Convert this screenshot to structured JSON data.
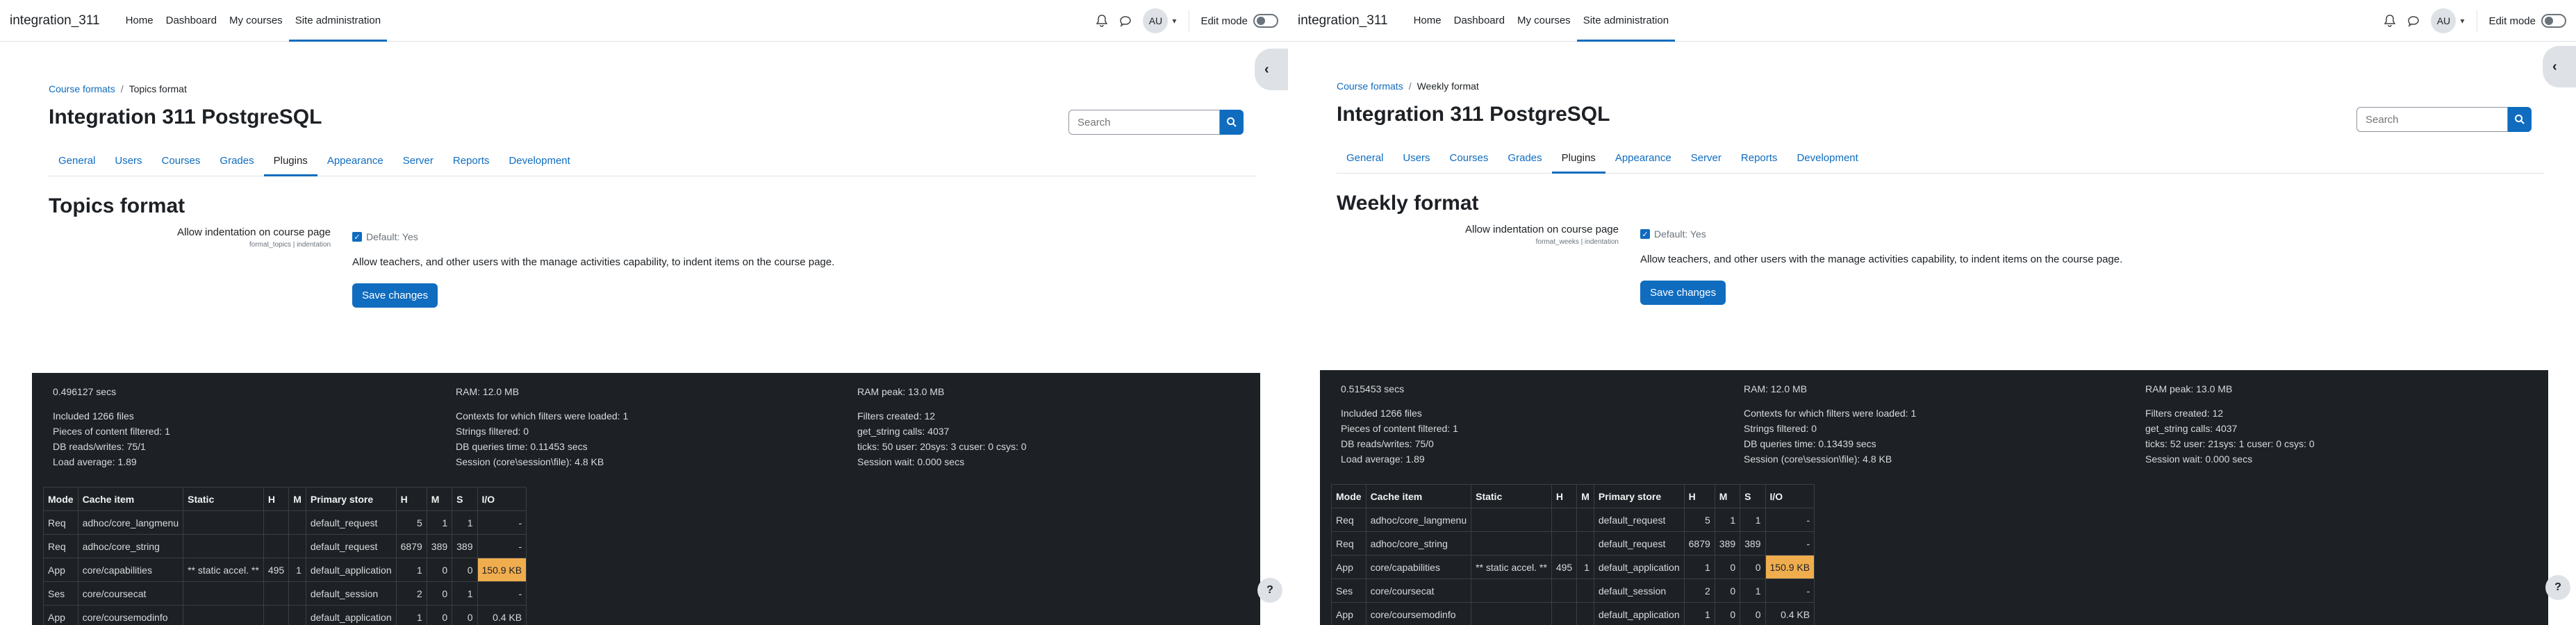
{
  "panels": [
    {
      "site_name": "integration_311",
      "nav": [
        "Home",
        "Dashboard",
        "My courses",
        "Site administration"
      ],
      "nav_active": 3,
      "avatar_initials": "AU",
      "edit_mode_label": "Edit mode",
      "breadcrumb": [
        "Course formats",
        "Topics format"
      ],
      "page_title": "Integration 311 PostgreSQL",
      "search_placeholder": "Search",
      "tabs": [
        "General",
        "Users",
        "Courses",
        "Grades",
        "Plugins",
        "Appearance",
        "Server",
        "Reports",
        "Development"
      ],
      "tab_active": 4,
      "section_title": "Topics format",
      "setting": {
        "label": "Allow indentation on course page",
        "id": "format_topics | indentation",
        "default": "Default: Yes",
        "description": "Allow teachers, and other users with the manage activities capability, to indent items on the course page.",
        "checked": true
      },
      "save_label": "Save changes",
      "perf": {
        "time": "0.496127 secs",
        "ram": "RAM: 12.0 MB",
        "ram_peak": "RAM peak: 13.0 MB",
        "col1": [
          "Included 1266 files",
          "Pieces of content filtered: 1",
          "DB reads/writes: 75/1",
          "Load average: 1.89"
        ],
        "col2": [
          "Contexts for which filters were loaded: 1",
          "Strings filtered: 0",
          "DB queries time: 0.11453 secs",
          "Session (core\\session\\file): 4.8 KB"
        ],
        "col3": [
          "Filters created: 12",
          "get_string calls: 4037",
          "ticks: 50 user: 20sys: 3 cuser: 0 csys: 0",
          "Session wait: 0.000 secs"
        ]
      },
      "cache_headers": [
        "Mode",
        "Cache item",
        "Static",
        "H",
        "M",
        "Primary store",
        "H",
        "M",
        "S",
        "I/O"
      ],
      "cache_rows": [
        [
          "Req",
          "adhoc/core_langmenu",
          "",
          "",
          "",
          "default_request",
          "5",
          "1",
          "1",
          "-"
        ],
        [
          "Req",
          "adhoc/core_string",
          "",
          "",
          "",
          "default_request",
          "6879",
          "389",
          "389",
          "-"
        ],
        [
          "App",
          "core/capabilities",
          "** static accel. **",
          "495",
          "1",
          "default_application",
          "1",
          "0",
          "0",
          "150.9 KB"
        ],
        [
          "Ses",
          "core/coursecat",
          "",
          "",
          "",
          "default_session",
          "2",
          "0",
          "1",
          "-"
        ],
        [
          "App",
          "core/coursemodinfo",
          "",
          "",
          "",
          "default_application",
          "1",
          "0",
          "0",
          "0.4 KB"
        ]
      ]
    },
    {
      "site_name": "integration_311",
      "nav": [
        "Home",
        "Dashboard",
        "My courses",
        "Site administration"
      ],
      "nav_active": 3,
      "avatar_initials": "AU",
      "edit_mode_label": "Edit mode",
      "breadcrumb": [
        "Course formats",
        "Weekly format"
      ],
      "page_title": "Integration 311 PostgreSQL",
      "search_placeholder": "Search",
      "tabs": [
        "General",
        "Users",
        "Courses",
        "Grades",
        "Plugins",
        "Appearance",
        "Server",
        "Reports",
        "Development"
      ],
      "tab_active": 4,
      "section_title": "Weekly format",
      "setting": {
        "label": "Allow indentation on course page",
        "id": "format_weeks | indentation",
        "default": "Default: Yes",
        "description": "Allow teachers, and other users with the manage activities capability, to indent items on the course page.",
        "checked": true
      },
      "save_label": "Save changes",
      "perf": {
        "time": "0.515453 secs",
        "ram": "RAM: 12.0 MB",
        "ram_peak": "RAM peak: 13.0 MB",
        "col1": [
          "Included 1266 files",
          "Pieces of content filtered: 1",
          "DB reads/writes: 75/0",
          "Load average: 1.89"
        ],
        "col2": [
          "Contexts for which filters were loaded: 1",
          "Strings filtered: 0",
          "DB queries time: 0.13439 secs",
          "Session (core\\session\\file): 4.8 KB"
        ],
        "col3": [
          "Filters created: 12",
          "get_string calls: 4037",
          "ticks: 52 user: 21sys: 1 cuser: 0 csys: 0",
          "Session wait: 0.000 secs"
        ]
      },
      "cache_headers": [
        "Mode",
        "Cache item",
        "Static",
        "H",
        "M",
        "Primary store",
        "H",
        "M",
        "S",
        "I/O"
      ],
      "cache_rows": [
        [
          "Req",
          "adhoc/core_langmenu",
          "",
          "",
          "",
          "default_request",
          "5",
          "1",
          "1",
          "-"
        ],
        [
          "Req",
          "adhoc/core_string",
          "",
          "",
          "",
          "default_request",
          "6879",
          "389",
          "389",
          "-"
        ],
        [
          "App",
          "core/capabilities",
          "** static accel. **",
          "495",
          "1",
          "default_application",
          "1",
          "0",
          "0",
          "150.9 KB"
        ],
        [
          "Ses",
          "core/coursecat",
          "",
          "",
          "",
          "default_session",
          "2",
          "0",
          "1",
          "-"
        ],
        [
          "App",
          "core/coursemodinfo",
          "",
          "",
          "",
          "default_application",
          "1",
          "0",
          "0",
          "0.4 KB"
        ]
      ]
    }
  ],
  "icons": {
    "bell": "bell-icon",
    "messages": "chat-icon",
    "drawer": "chevron-left-icon",
    "search": "search-icon",
    "help": "question-icon"
  },
  "colors": {
    "primary": "#0f6cbf",
    "footer_bg": "#1d2125",
    "highlight": "#f0ad4e"
  }
}
